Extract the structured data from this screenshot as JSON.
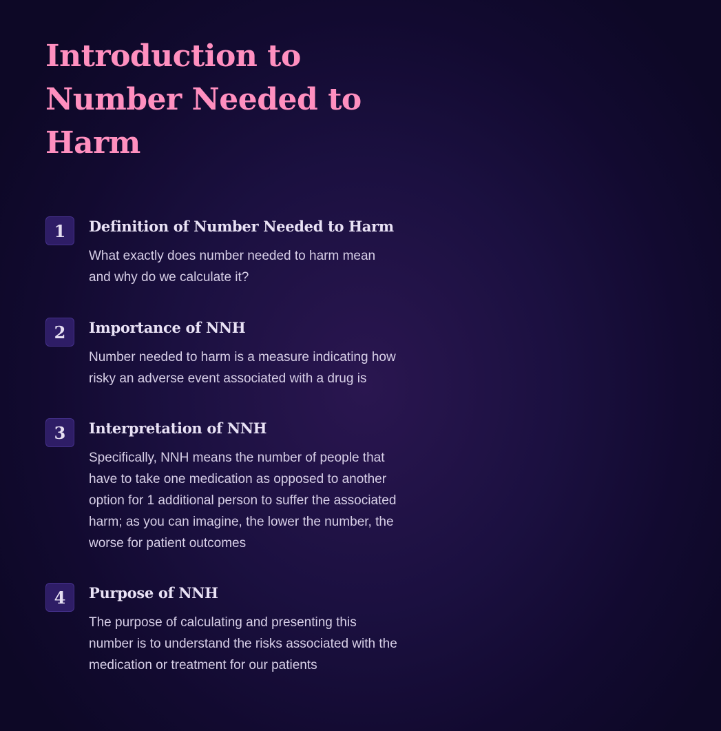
{
  "title": "Introduction to Number Needed to Harm",
  "items": [
    {
      "number": "1",
      "title": "Definition of Number Needed to Harm",
      "description": "What exactly does number needed to harm mean and why do we calculate it?"
    },
    {
      "number": "2",
      "title": "Importance of NNH",
      "description": "Number needed to harm is a measure indicating how risky an adverse event associated with a drug is"
    },
    {
      "number": "3",
      "title": "Interpretation of NNH",
      "description": "Specifically, NNH means the number of people that have to take one medication as opposed to another option for 1 additional person to suffer the associated harm; as you can imagine, the lower the number, the worse for patient outcomes"
    },
    {
      "number": "4",
      "title": "Purpose of NNH",
      "description": "The purpose of calculating and presenting this number is to understand the risks associated with the medication or treatment for our patients"
    }
  ],
  "colors": {
    "title": "#ff8fbf",
    "badge_bg": "#2e1d66",
    "background": "#140c34"
  }
}
